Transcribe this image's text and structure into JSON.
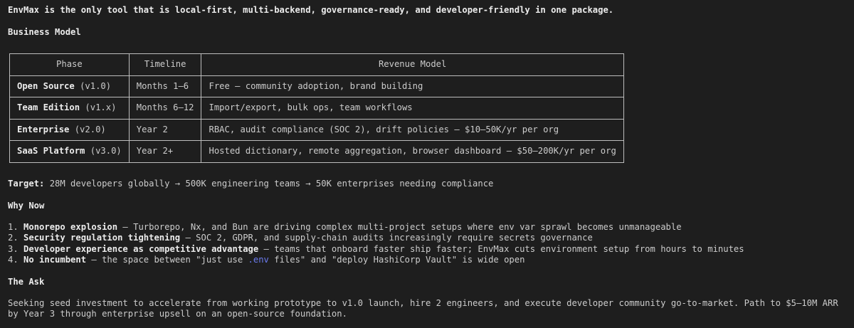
{
  "intro": "EnvMax is the only tool that is local-first, multi-backend, governance-ready, and developer-friendly in one package.",
  "business_model": {
    "heading": "Business Model",
    "columns": [
      "Phase",
      "Timeline",
      "Revenue Model"
    ],
    "rows": [
      {
        "phase": "Open Source",
        "version": "(v1.0)",
        "timeline": "Months 1–6",
        "revenue": "Free — community adoption, brand building"
      },
      {
        "phase": "Team Edition",
        "version": "(v1.x)",
        "timeline": "Months 6–12",
        "revenue": "Import/export, bulk ops, team workflows"
      },
      {
        "phase": "Enterprise",
        "version": "(v2.0)",
        "timeline": "Year 2",
        "revenue": "RBAC, audit compliance (SOC 2), drift policies — $10–50K/yr per org"
      },
      {
        "phase": "SaaS Platform",
        "version": "(v3.0)",
        "timeline": "Year 2+",
        "revenue": "Hosted dictionary, remote aggregation, browser dashboard — $50–200K/yr per org"
      }
    ]
  },
  "target": {
    "label": "Target:",
    "text": " 28M developers globally → 500K engineering teams → 50K enterprises needing compliance"
  },
  "why_now": {
    "heading": "Why Now",
    "items": [
      {
        "num": "1. ",
        "title": "Monorepo explosion",
        "text": " — Turborepo, Nx, and Bun are driving complex multi-project setups where env var sprawl becomes unmanageable"
      },
      {
        "num": "2. ",
        "title": "Security regulation tightening",
        "text": " — SOC 2, GDPR, and supply-chain audits increasingly require secrets governance"
      },
      {
        "num": "3. ",
        "title": "Developer experience as competitive advantage",
        "text": " — teams that onboard faster ship faster; EnvMax cuts environment setup from hours to minutes"
      },
      {
        "num": "4. ",
        "title": "No incumbent",
        "text_before": " — the space between \"just use ",
        "code": ".env",
        "text_after": " files\" and \"deploy HashiCorp Vault\" is wide open"
      }
    ]
  },
  "ask": {
    "heading": "The Ask",
    "text": "Seeking seed investment to accelerate from working prototype to v1.0 launch, hire 2 engineers, and execute developer community go-to-market. Path to $5–10M ARR by Year 3 through enterprise upsell on an open-source foundation."
  }
}
